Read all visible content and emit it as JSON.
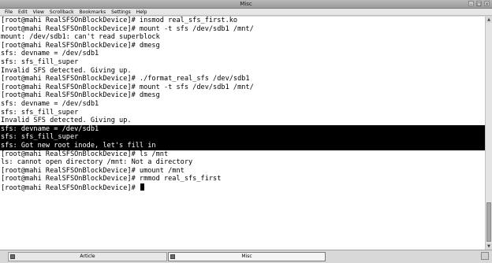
{
  "window": {
    "title": "Misc"
  },
  "menu": [
    "File",
    "Edit",
    "View",
    "Scrollback",
    "Bookmarks",
    "Settings",
    "Help"
  ],
  "terminal": {
    "lines": [
      {
        "text": "[root@mahi RealSFSOnBlockDevice]# insmod real_sfs_first.ko",
        "selected": false
      },
      {
        "text": "[root@mahi RealSFSOnBlockDevice]# mount -t sfs /dev/sdb1 /mnt/",
        "selected": false
      },
      {
        "text": "mount: /dev/sdb1: can't read superblock",
        "selected": false
      },
      {
        "text": "[root@mahi RealSFSOnBlockDevice]# dmesg",
        "selected": false
      },
      {
        "text": "sfs: devname = /dev/sdb1",
        "selected": false
      },
      {
        "text": "sfs: sfs_fill_super",
        "selected": false
      },
      {
        "text": "Invalid SFS detected. Giving up.",
        "selected": false
      },
      {
        "text": "[root@mahi RealSFSOnBlockDevice]# ./format_real_sfs /dev/sdb1",
        "selected": false
      },
      {
        "text": "[root@mahi RealSFSOnBlockDevice]# mount -t sfs /dev/sdb1 /mnt/",
        "selected": false
      },
      {
        "text": "[root@mahi RealSFSOnBlockDevice]# dmesg",
        "selected": false
      },
      {
        "text": "sfs: devname = /dev/sdb1",
        "selected": false
      },
      {
        "text": "sfs: sfs_fill_super",
        "selected": false
      },
      {
        "text": "Invalid SFS detected. Giving up.",
        "selected": false
      },
      {
        "text": "sfs: devname = /dev/sdb1",
        "selected": true
      },
      {
        "text": "sfs: sfs_fill_super",
        "selected": true
      },
      {
        "text": "sfs: Got new root inode, let's fill in",
        "selected": true
      },
      {
        "text": "[root@mahi RealSFSOnBlockDevice]# ls /mnt",
        "selected": false
      },
      {
        "text": "ls: cannot open directory /mnt: Not a directory",
        "selected": false
      },
      {
        "text": "[root@mahi RealSFSOnBlockDevice]# umount /mnt",
        "selected": false
      },
      {
        "text": "[root@mahi RealSFSOnBlockDevice]# rmmod real_sfs_first",
        "selected": false
      },
      {
        "text": "[root@mahi RealSFSOnBlockDevice]# ",
        "selected": false,
        "cursor": true
      }
    ]
  },
  "taskbar": {
    "tasks": [
      {
        "label": "Article",
        "active": false
      },
      {
        "label": "Misc",
        "active": true
      }
    ]
  }
}
